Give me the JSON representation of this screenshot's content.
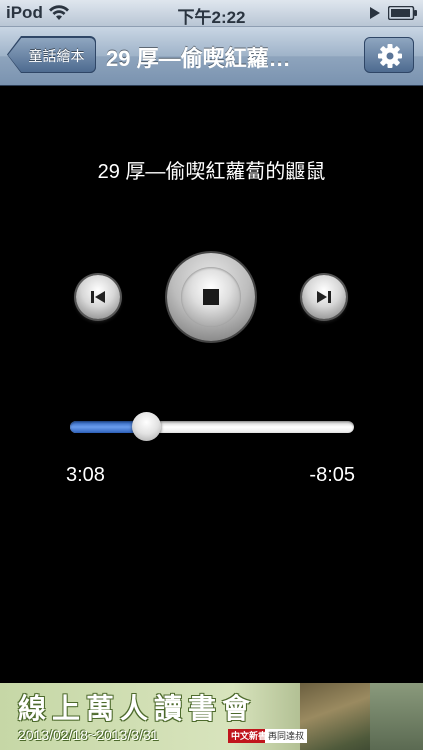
{
  "status_bar": {
    "carrier": "iPod",
    "time": "下午2:22",
    "icons": [
      "wifi-icon",
      "play-state-icon",
      "battery-icon"
    ]
  },
  "nav_bar": {
    "back_label": "童話繪本",
    "title": "29 厚—偷喫紅蘿…",
    "settings_icon": "gear-icon"
  },
  "player": {
    "track_title": "29 厚—偷喫紅蘿蔔的鼴鼠",
    "controls": [
      "previous-icon",
      "stop-icon",
      "next-icon"
    ],
    "progress_fraction": 0.27,
    "elapsed": "3:08",
    "remaining": "-8:05"
  },
  "ad": {
    "headline": "線上萬人讀書會",
    "dates": "2013/02/18~2013/3/31",
    "brand": "中文新書",
    "brand2": "再同達叔"
  },
  "colors": {
    "accent_blue": "#3f74d0",
    "nav_blue": "#7a93b0"
  }
}
